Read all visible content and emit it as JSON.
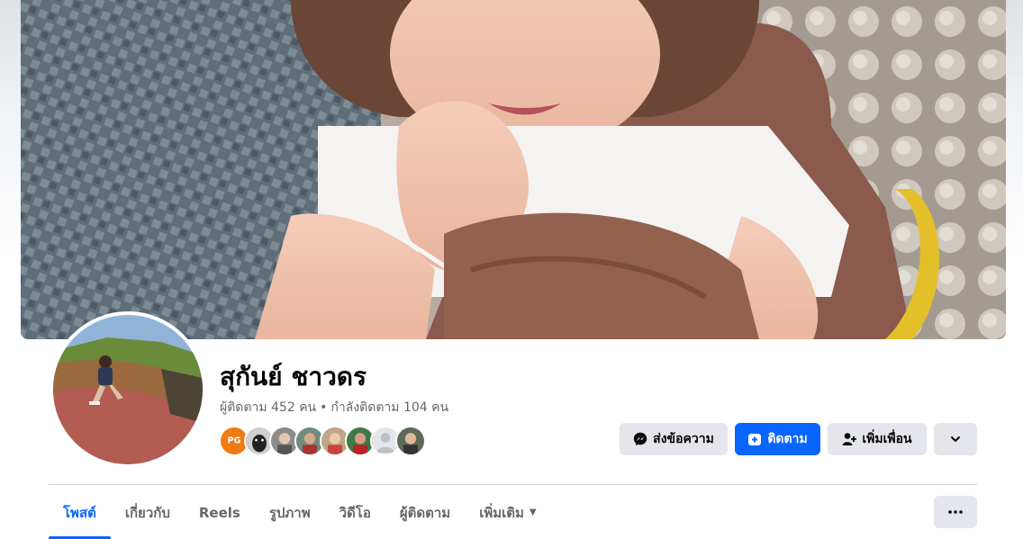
{
  "profile": {
    "name": "สุกันย์ ชาวดร",
    "followers": "ผู้ติดตาม 452 คน",
    "separator": "•",
    "following": "กำลังติดตาม 104 คน"
  },
  "friends": [
    {
      "name": "pg-games",
      "badge": "PG"
    },
    {
      "name": "dog"
    },
    {
      "name": "friend-3"
    },
    {
      "name": "friend-4"
    },
    {
      "name": "friend-5"
    },
    {
      "name": "friend-6"
    },
    {
      "name": "default-avatar"
    },
    {
      "name": "friend-8"
    }
  ],
  "actions": {
    "message_label": "ส่งข้อความ",
    "follow_label": "ติดตาม",
    "add_friend_label": "เพิ่มเพื่อน"
  },
  "tabs": [
    {
      "label": "โพสต์",
      "active": true
    },
    {
      "label": "เกี่ยวกับ"
    },
    {
      "label": "Reels"
    },
    {
      "label": "รูปภาพ"
    },
    {
      "label": "วิดีโอ"
    },
    {
      "label": "ผู้ติดตาม"
    },
    {
      "label": "เพิ่มเติม"
    }
  ],
  "colors": {
    "accent": "#0866ff",
    "secondary_button": "#e4e6eb",
    "muted_text": "#65676b"
  }
}
